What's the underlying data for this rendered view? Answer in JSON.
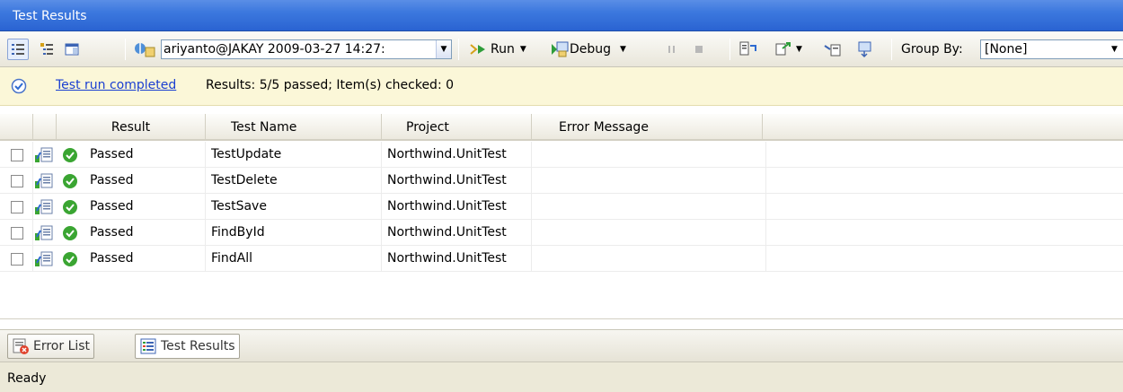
{
  "window": {
    "title": "Test Results"
  },
  "toolbar": {
    "run_combo": "ariyanto@JAKAY 2009-03-27 14:27:",
    "run_label": "Run",
    "debug_label": "Debug",
    "group_by_label": "Group By:",
    "group_by_value": "[None]"
  },
  "info": {
    "link": "Test run completed",
    "summary": "Results: 5/5 passed;  Item(s) checked: 0"
  },
  "columns": {
    "result": "Result",
    "test_name": "Test Name",
    "project": "Project",
    "error": "Error Message"
  },
  "rows": [
    {
      "result": "Passed",
      "test_name": "TestUpdate",
      "project": "Northwind.UnitTest",
      "error": ""
    },
    {
      "result": "Passed",
      "test_name": "TestDelete",
      "project": "Northwind.UnitTest",
      "error": ""
    },
    {
      "result": "Passed",
      "test_name": "TestSave",
      "project": "Northwind.UnitTest",
      "error": ""
    },
    {
      "result": "Passed",
      "test_name": "FindById",
      "project": "Northwind.UnitTest",
      "error": ""
    },
    {
      "result": "Passed",
      "test_name": "FindAll",
      "project": "Northwind.UnitTest",
      "error": ""
    }
  ],
  "bottom_tabs": [
    {
      "label": "Error List"
    },
    {
      "label": "Test Results"
    }
  ],
  "status": {
    "text": "Ready"
  },
  "colors": {
    "title_bar": "#3c78de",
    "info_bar": "#fbf7d8",
    "link": "#1a3fd1",
    "pass": "#3aa532"
  }
}
